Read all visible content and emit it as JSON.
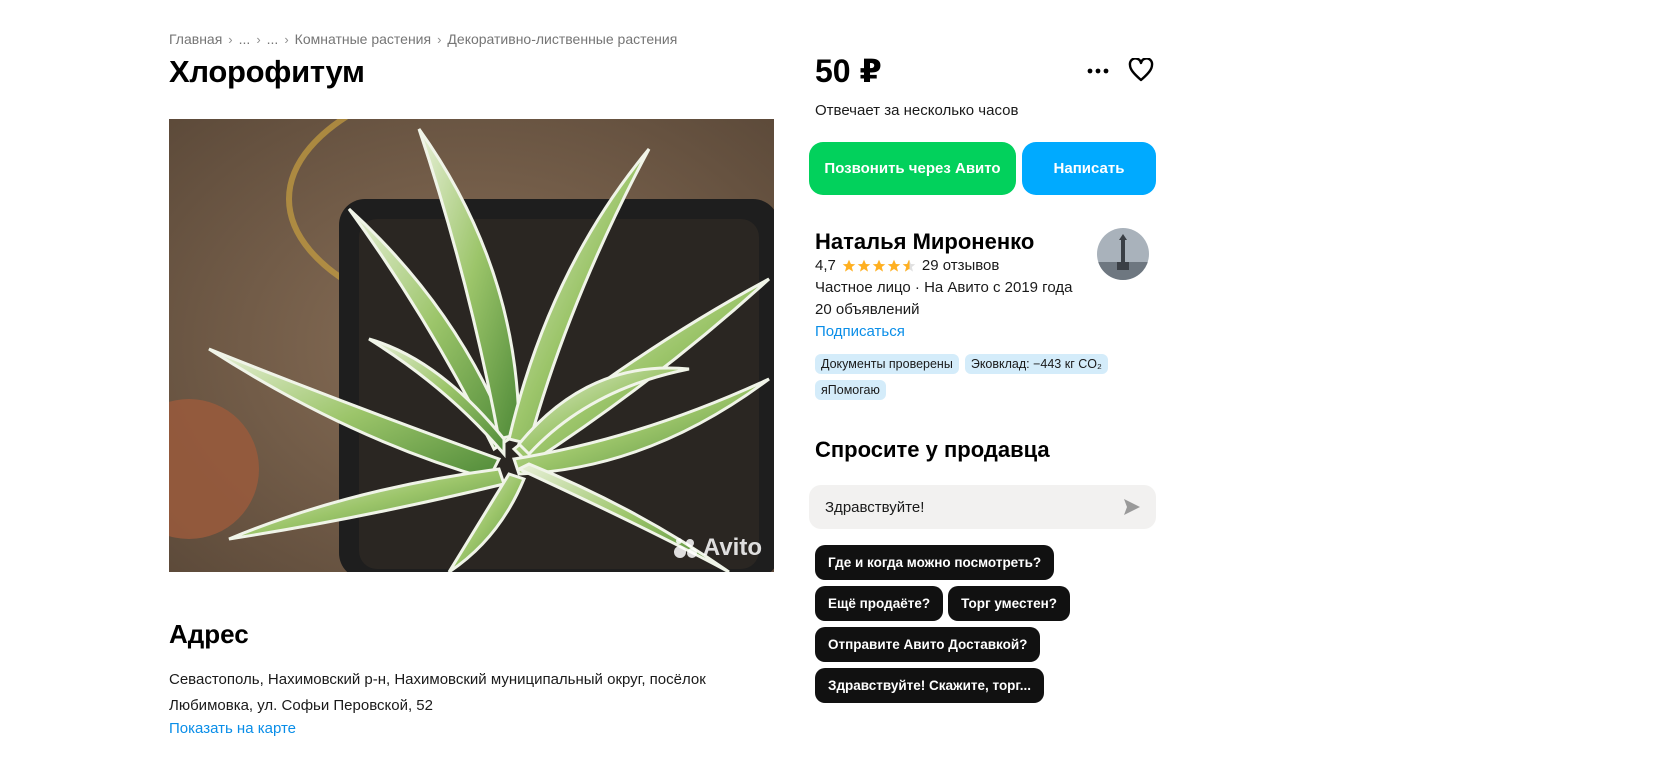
{
  "breadcrumb": {
    "items": [
      "Главная",
      "...",
      "...",
      "Комнатные растения",
      "Декоративно-лиственные растения"
    ]
  },
  "listing": {
    "title": "Хлорофитум",
    "watermark": "Avito"
  },
  "address": {
    "title": "Адрес",
    "text": "Севастополь, Нахимовский р-н, Нахимовский муниципальный округ, посёлок Любимовка, ул. Софьи Перовской, 52",
    "map_link": "Показать на карте"
  },
  "price": {
    "value": "50 ₽",
    "responds": "Отвечает за несколько часов"
  },
  "actions": {
    "call_label": "Позвонить через Авито",
    "write_label": "Написать",
    "more_icon": "more-dots-icon",
    "favorite_icon": "heart-icon"
  },
  "seller": {
    "name": "Наталья Мироненко",
    "rating": "4,7",
    "stars": 4.5,
    "reviews": "29 отзывов",
    "type": "Частное лицо · На Авито с 2019 года",
    "ads": "20 объявлений",
    "subscribe": "Подписаться",
    "badges": [
      "Документы проверены",
      "Эковклад: −443 кг CO₂",
      "яПомогаю"
    ]
  },
  "ask": {
    "title": "Спросите у продавца",
    "input_value": "Здравствуйте!",
    "chips": [
      "Где и когда можно посмотреть?",
      "Ещё продаёте?",
      "Торг уместен?",
      "Отправите Авито Доставкой?",
      "Здравствуйте! Скажите, торг..."
    ]
  },
  "colors": {
    "call_button": "#02d15c",
    "write_button": "#00aaff",
    "link": "#0a8ee8",
    "star": "#ffb021",
    "badge_bg": "#d4ecfa",
    "chip_bg": "#111111"
  }
}
